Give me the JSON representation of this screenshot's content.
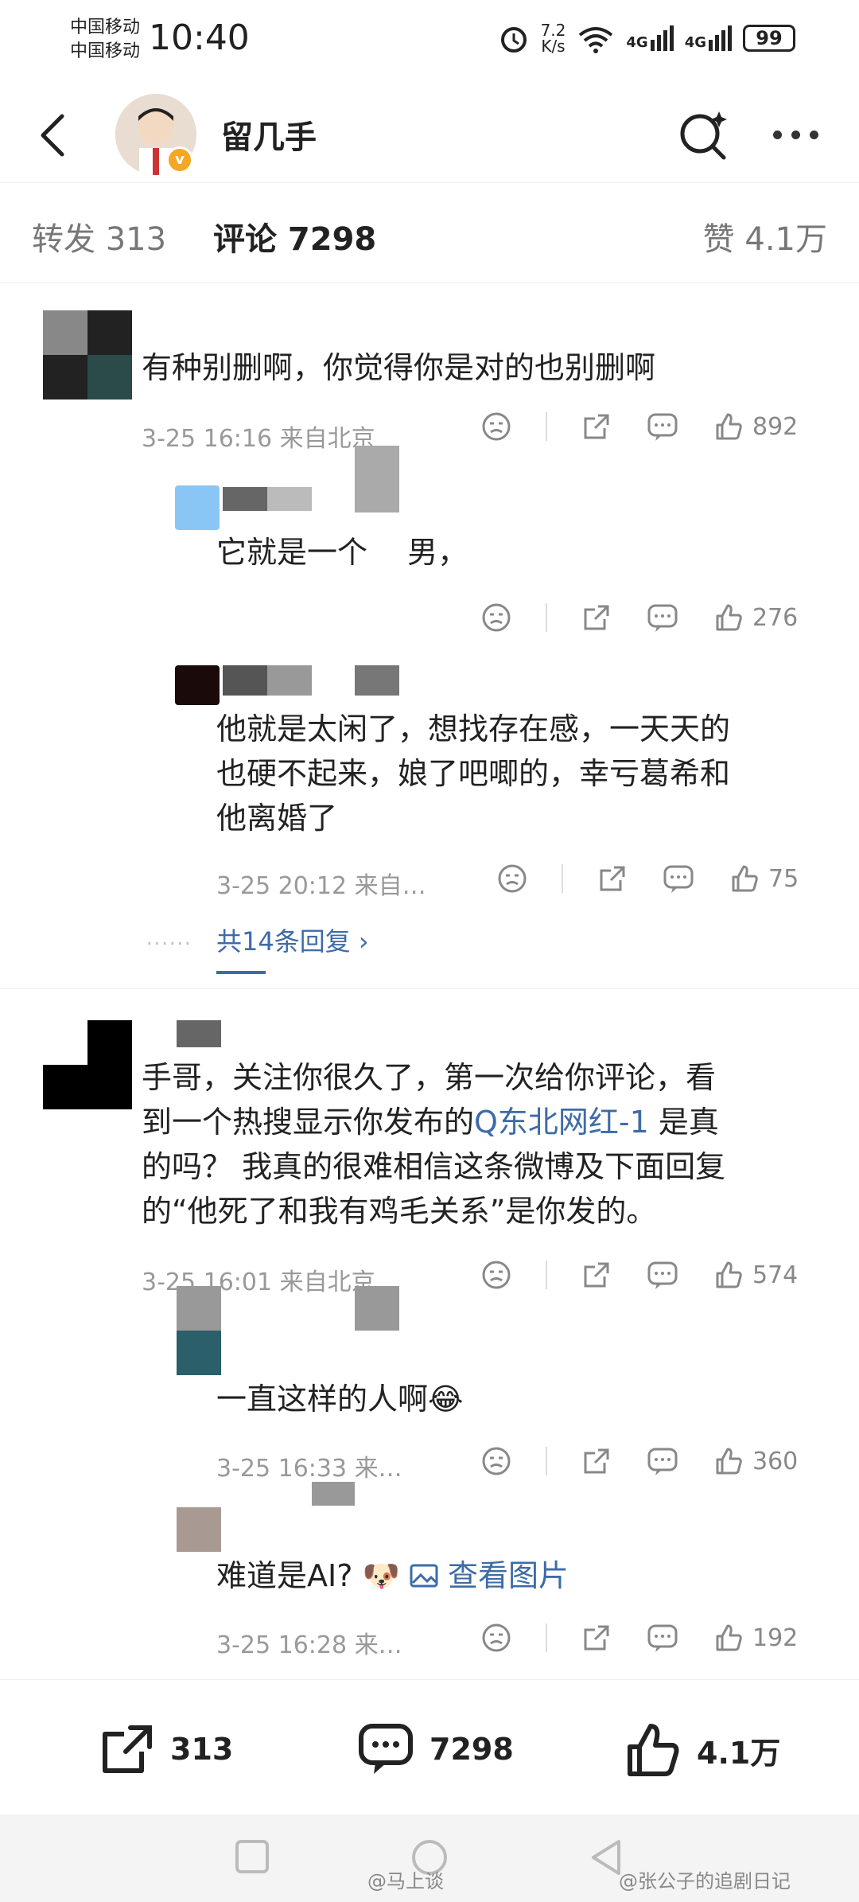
{
  "status": {
    "carrier1": "中国移动",
    "carrier2": "中国移动",
    "time": "10:40",
    "speed_value": "7.2",
    "speed_unit": "K/s",
    "wifi": "6",
    "net1": "4G",
    "net2": "4G",
    "battery": "99"
  },
  "nav": {
    "username": "留几手",
    "badge": "v"
  },
  "tabs": [
    {
      "label": "转发 313"
    },
    {
      "label": "评论 7298"
    },
    {
      "label": "赞 4.1万"
    }
  ],
  "comments": [
    {
      "text": "有种别删啊，你觉得你是对的也别删啊",
      "meta": "3-25 16:16 来自北京",
      "likes": "892"
    },
    {
      "text": "它就是一个 　男，",
      "meta": "",
      "likes": "276"
    },
    {
      "text_lines": [
        "他就是太闲了，想找存在感，一天天的",
        "也硬不起来，娘了吧唧的，幸亏葛希和",
        "他离婚了"
      ],
      "meta": "3-25 20:12 来自…",
      "likes": "75"
    },
    {
      "more": "共14条回复 ›"
    },
    {
      "text_line1": "手哥，关注你很久了，第一次给你评论，看",
      "text_line2_a": "到一个热搜显示你发布的",
      "text_line2_link": "Q东北网红-1",
      "text_line2_b": " 是真",
      "text_line3": "的吗？ 我真的很难相信这条微博及下面回复",
      "text_line4": "的“他死了和我有鸡毛关系”是你发的。",
      "meta": "3-25 16:01 来自北京",
      "likes": "574"
    },
    {
      "text": "一直这样的人啊😂",
      "meta": "3-25 16:33 来…",
      "likes": "360"
    },
    {
      "text": "难道是AI? 🐶",
      "image_link": "查看图片",
      "meta": "3-25 16:28 来…",
      "likes": "192"
    }
  ],
  "bottom": {
    "repost": "313",
    "comment": "7298",
    "like": "4.1万"
  },
  "watermarks": {
    "left": "@马上谈",
    "right": "@张公子的追剧日记"
  },
  "colors": {
    "link": "#3d6ba8",
    "badge": "#f5a623"
  }
}
